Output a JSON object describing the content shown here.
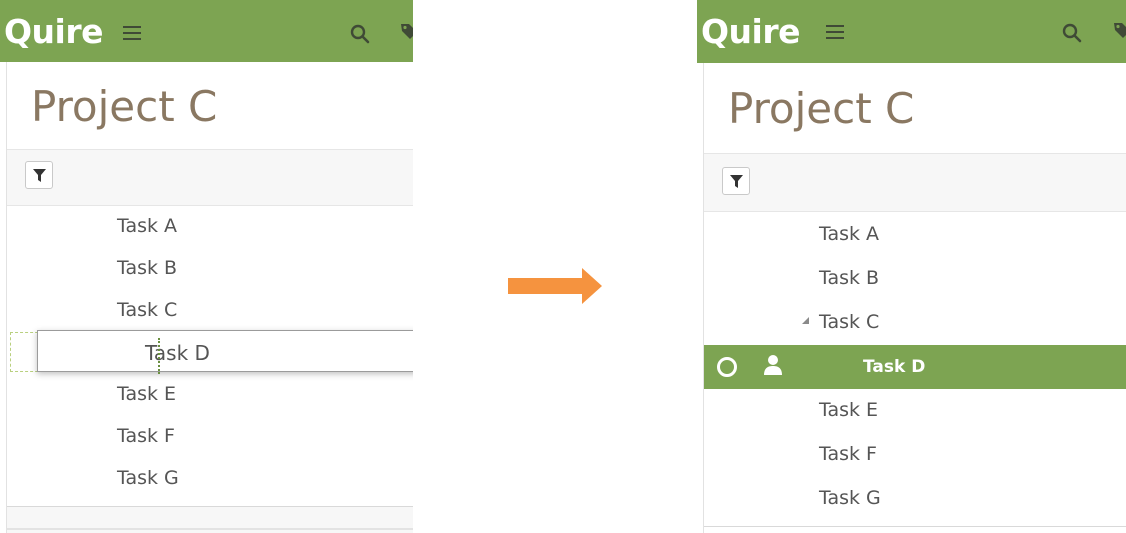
{
  "app": {
    "logo_text": "Quire"
  },
  "colors": {
    "brand_green": "#7da452",
    "title_brown": "#8a7862",
    "arrow_orange": "#f5933f",
    "task_text": "#555555"
  },
  "icons": {
    "menu": "hamburger-menu-icon",
    "search": "search-icon",
    "tag": "tag-icon",
    "filter": "filter-icon",
    "transition": "right-arrow-icon",
    "expand": "expand-triangle-icon",
    "complete": "check-circle-icon",
    "assignee": "person-icon"
  },
  "before": {
    "project_title": "Project C",
    "tasks": [
      "Task A",
      "Task B",
      "Task C",
      "Task E",
      "Task F",
      "Task G"
    ],
    "dragging_task": "Task D"
  },
  "after": {
    "project_title": "Project C",
    "tasks": [
      "Task A",
      "Task B",
      "Task C",
      "Task D",
      "Task E",
      "Task F",
      "Task G"
    ],
    "selected_task": "Task D",
    "expanded_parent": "Task C",
    "indented_task": "Task D"
  }
}
